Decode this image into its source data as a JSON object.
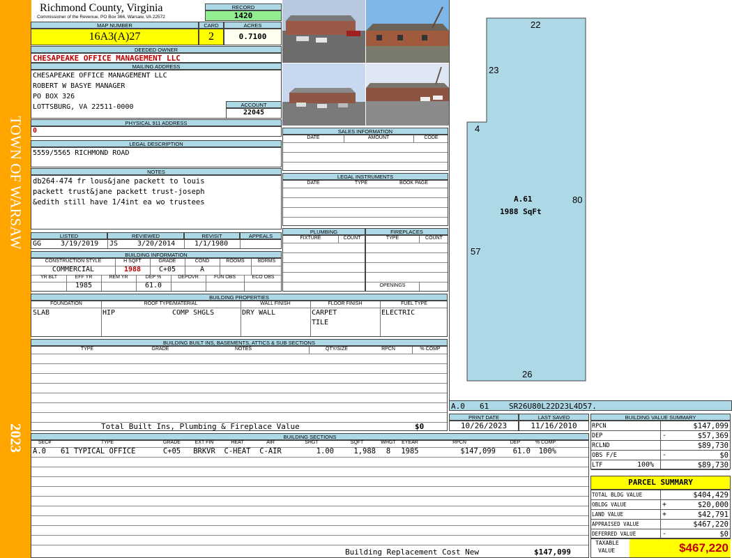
{
  "sidebar": {
    "title": "TOWN OF WARSAW",
    "year": "2023"
  },
  "header": {
    "county": "Richmond County, Virginia",
    "subtitle": "Commissioner of the Revenue, PO Box 366, Warsaw, VA 22572",
    "record_label": "RECORD",
    "record": "1420",
    "map_label": "MAP NUMBER",
    "map_number": "16A3(A)27",
    "card_label": "CARD",
    "card": "2",
    "acres_label": "ACRES",
    "acres": "0.7100"
  },
  "owner": {
    "label": "DEEDED OWNER",
    "name": "CHESAPEAKE OFFICE MANAGEMENT LLC"
  },
  "mailing": {
    "label": "MAILING ADDRESS",
    "lines": [
      "CHESAPEAKE OFFICE MANAGEMENT LLC",
      "ROBERT W BASYE MANAGER",
      "PO BOX 326",
      "LOTTSBURG, VA 22511-0000"
    ],
    "account_label": "ACCOUNT",
    "account": "22045"
  },
  "physical": {
    "label": "PHYSICAL 911 ADDRESS",
    "value": "0"
  },
  "legal": {
    "label": "LEGAL DESCRIPTION",
    "value": "5559/5565 RICHMOND ROAD"
  },
  "notes": {
    "label": "NOTES",
    "lines": [
      "db264-474 fr lous&jane packett to louis",
      "packett trust&jane packett trust-joseph",
      "&edith still have 1/4int ea wo trustees"
    ]
  },
  "listed": {
    "listed_label": "LISTED",
    "listed_by": "GG",
    "listed_date": "3/19/2019",
    "reviewed_label": "REVIEWED",
    "reviewed_by": "JS",
    "reviewed_date": "3/20/2014",
    "revisit_label": "REVISIT",
    "revisit": "1/1/1980",
    "appeals_label": "APPEALS",
    "appeals": ""
  },
  "building_info": {
    "label": "BUILDING INFORMATION",
    "h": [
      "CONSTRUCTION STYLE",
      "H SQFT",
      "GRADE",
      "COND",
      "ROOMS",
      "BDRMS"
    ],
    "v": [
      "COMMERCIAL",
      "1988",
      "C+05",
      "A",
      "",
      ""
    ],
    "h2": [
      "YR BLT",
      "EFF YR",
      "REM YR",
      "DEP %",
      "DEPOVR",
      "FUN OBS",
      "ECO OBS"
    ],
    "v2": [
      "",
      "1985",
      "",
      "61.0",
      "",
      "",
      ""
    ]
  },
  "sales": {
    "label": "SALES INFORMATION",
    "cols": [
      "DATE",
      "AMOUNT",
      "CODE"
    ]
  },
  "legal_instruments": {
    "label": "LEGAL INSTRUMENTS",
    "cols": [
      "DATE",
      "TYPE",
      "BOOK PAGE"
    ]
  },
  "plumbing": {
    "label": "PLUMBING",
    "cols": [
      "FIXTURE",
      "COUNT"
    ]
  },
  "fireplaces": {
    "label": "FIREPLACES",
    "cols": [
      "TYPE",
      "COUNT"
    ],
    "openings": "OPENINGS"
  },
  "building_props": {
    "label": "BUILDING PROPERTIES",
    "cols": [
      "FOUNDATION",
      "ROOF TYPE/MATERIAL",
      "WALL FINISH",
      "FLOOR FINISH",
      "FUEL TYPE"
    ],
    "foundation": "SLAB",
    "roof_type": "HIP",
    "roof_material": "COMP SHGLS",
    "wall": "DRY WALL",
    "floor1": "CARPET",
    "floor2": "TILE",
    "fuel": "ELECTRIC"
  },
  "builtins": {
    "label": "BUILDING BUILT INS, BASEMENTS, ATTICS & SUB SECTIONS",
    "cols": [
      "TYPE",
      "GRADE",
      "NOTES",
      "QTY/SIZE",
      "RPCN",
      "% COMP"
    ],
    "total_label": "Total Built Ins, Plumbing & Fireplace Value",
    "total": "$0"
  },
  "sections": {
    "label": "BUILDING SECTIONS",
    "cols": [
      "SEC#",
      "TYPE",
      "GRADE",
      "EXT FIN",
      "HEAT",
      "AIR",
      "SHGT",
      "SQFT",
      "WHGT",
      "EYEAR",
      "RPCN",
      "DEP",
      "% COMP"
    ],
    "rows": [
      [
        "A.0",
        "61 TYPICAL OFFICE",
        "C+05",
        "BRKVR",
        "C-HEAT",
        "C-AIR",
        "1.00",
        "1,988",
        "8",
        "1985",
        "$147,099",
        "61.0",
        "100%"
      ]
    ],
    "replacement_label": "Building Replacement Cost New",
    "replacement": "$147,099"
  },
  "sketch": {
    "label1": "A.61",
    "label2": "1988 SqFt",
    "dims": [
      "22",
      "23",
      "4",
      "80",
      "57",
      "26"
    ],
    "code_sec": "A.0",
    "code_type": "61",
    "code": "SR26U80L22D23L4D57."
  },
  "dates": {
    "print_label": "PRINT DATE",
    "print": "10/26/2023",
    "saved_label": "LAST SAVED",
    "saved": "11/16/2010"
  },
  "value_summary": {
    "label": "BUILDING VALUE SUMMARY",
    "rows": [
      {
        "k": "RPCN",
        "sign": "",
        "v": "$147,099"
      },
      {
        "k": "DEP",
        "sign": "-",
        "v": "$57,369"
      },
      {
        "k": "RCLND",
        "sign": "",
        "v": "$89,730"
      },
      {
        "k": "OBS F/E",
        "sign": "-",
        "v": "$0"
      },
      {
        "k": "LTF",
        "pct": "100%",
        "sign": "",
        "v": "$89,730"
      }
    ]
  },
  "parcel": {
    "label": "PARCEL SUMMARY",
    "rows": [
      {
        "k": "TOTAL BLDG VALUE",
        "sign": "",
        "v": "$404,429"
      },
      {
        "k": "OBLDG VALUE",
        "sign": "+",
        "v": "$20,000"
      },
      {
        "k": "LAND VALUE",
        "sign": "+",
        "v": "$42,791"
      },
      {
        "k": "APPRAISED VALUE",
        "sign": "",
        "v": "$467,220"
      },
      {
        "k": "DEFERRED VALUE",
        "sign": "-",
        "v": "$0"
      }
    ],
    "taxable_label1": "TAXABLE",
    "taxable_label2": "VALUE",
    "taxable": "$467,220"
  },
  "colors": {
    "sidebar": "#ffa500",
    "header_fill": "#add8e6",
    "yellow": "#ffff00",
    "green": "#90ee90",
    "red": "#c00000"
  }
}
